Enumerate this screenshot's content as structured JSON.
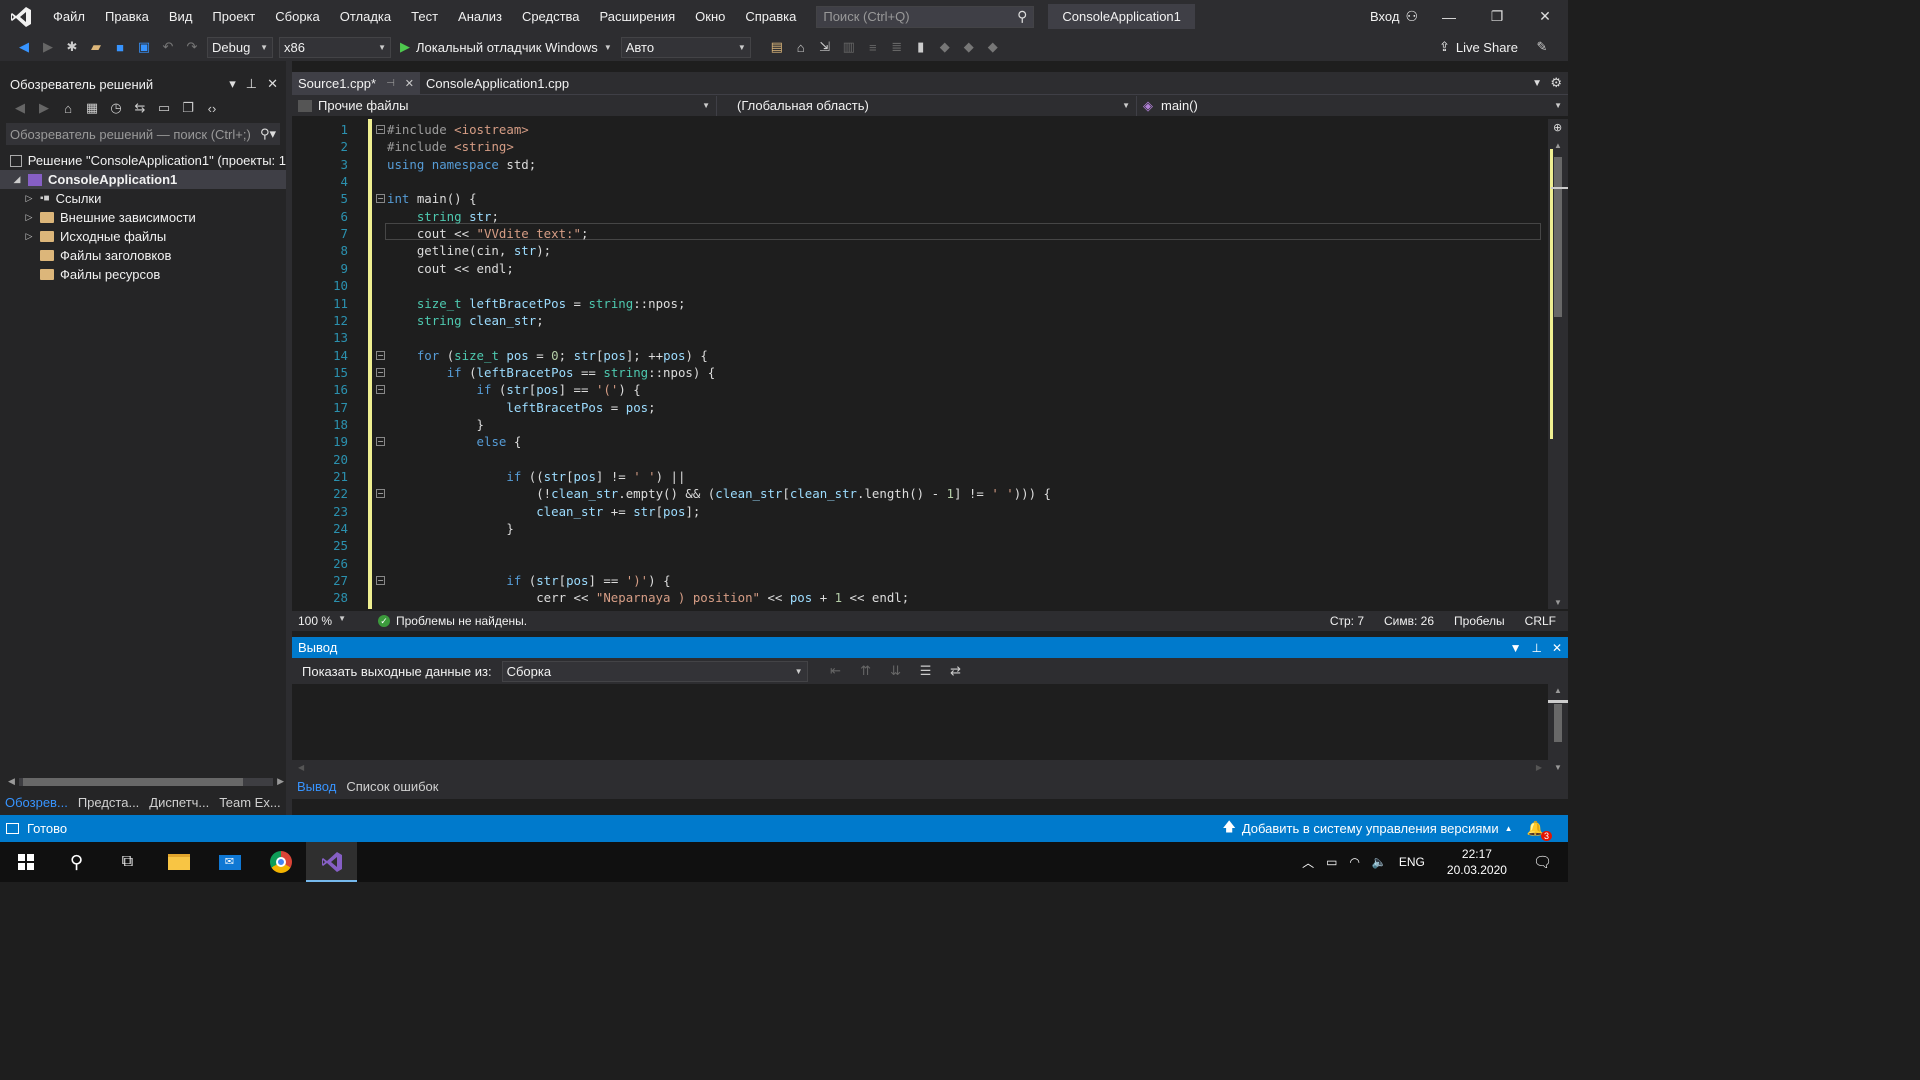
{
  "titlebar": {
    "menu": [
      "Файл",
      "Правка",
      "Вид",
      "Проект",
      "Сборка",
      "Отладка",
      "Тест",
      "Анализ",
      "Средства",
      "Расширения",
      "Окно",
      "Справка"
    ],
    "search_placeholder": "Поиск (Ctrl+Q)",
    "app_title": "ConsoleApplication1",
    "signin": "Вход"
  },
  "toolbar": {
    "config": "Debug",
    "platform": "x86",
    "run_label": "Локальный отладчик Windows",
    "run_mode": "Авто",
    "live_share": "Live Share"
  },
  "solution_explorer": {
    "title": "Обозреватель решений",
    "search_placeholder": "Обозреватель решений — поиск (Ctrl+;)",
    "solution": "Решение \"ConsoleApplication1\" (проекты: 1",
    "project": "ConsoleApplication1",
    "items": [
      "Ссылки",
      "Внешние зависимости",
      "Исходные файлы",
      "Файлы заголовков",
      "Файлы ресурсов"
    ],
    "bottom_tabs": [
      "Обозрев...",
      "Предста...",
      "Диспетч...",
      "Team Ex..."
    ]
  },
  "editor": {
    "tabs": [
      "Source1.cpp*",
      "ConsoleApplication1.cpp"
    ],
    "nav_files": "Прочие файлы",
    "nav_scope": "(Глобальная область)",
    "nav_member": "main()",
    "zoom": "100 %",
    "issues": "Проблемы не найдены.",
    "line": "Стр: 7",
    "col": "Симв: 26",
    "spaces": "Пробелы",
    "eol": "CRLF"
  },
  "code_lines": [
    {
      "n": "1",
      "html": "<span class='pp'>#include</span> <span class='st'>&lt;iostream&gt;</span>"
    },
    {
      "n": "2",
      "html": "<span class='pp'>#include</span> <span class='st'>&lt;string&gt;</span>"
    },
    {
      "n": "3",
      "html": "<span class='kw'>using namespace</span> std;"
    },
    {
      "n": "4",
      "html": ""
    },
    {
      "n": "5",
      "html": "<span class='kw'>int</span> main() {"
    },
    {
      "n": "6",
      "html": "    <span class='ty'>string</span> <span class='vr'>str</span>;"
    },
    {
      "n": "7",
      "html": "    cout &lt;&lt; <span class='st'>\"VVdite text:\"</span>;"
    },
    {
      "n": "8",
      "html": "    getline(cin, <span class='vr'>str</span>);"
    },
    {
      "n": "9",
      "html": "    cout &lt;&lt; endl;"
    },
    {
      "n": "10",
      "html": ""
    },
    {
      "n": "11",
      "html": "    <span class='ty'>size_t</span> <span class='vr'>leftBracetPos</span> = <span class='ty'>string</span>::npos;"
    },
    {
      "n": "12",
      "html": "    <span class='ty'>string</span> <span class='vr'>clean_str</span>;"
    },
    {
      "n": "13",
      "html": ""
    },
    {
      "n": "14",
      "html": "    <span class='kw'>for</span> (<span class='ty'>size_t</span> <span class='vr'>pos</span> = <span class='nm'>0</span>; <span class='vr'>str</span>[<span class='vr'>pos</span>]; ++<span class='vr'>pos</span>) {"
    },
    {
      "n": "15",
      "html": "        <span class='kw'>if</span> (<span class='vr'>leftBracetPos</span> == <span class='ty'>string</span>::npos) {"
    },
    {
      "n": "16",
      "html": "            <span class='kw'>if</span> (<span class='vr'>str</span>[<span class='vr'>pos</span>] == <span class='st'>'('</span>) {"
    },
    {
      "n": "17",
      "html": "                <span class='vr'>leftBracetPos</span> = <span class='vr'>pos</span>;"
    },
    {
      "n": "18",
      "html": "            }"
    },
    {
      "n": "19",
      "html": "            <span class='kw'>else</span> {"
    },
    {
      "n": "20",
      "html": ""
    },
    {
      "n": "21",
      "html": "                <span class='kw'>if</span> ((<span class='vr'>str</span>[<span class='vr'>pos</span>] != <span class='st'>' '</span>) ||"
    },
    {
      "n": "22",
      "html": "                    (!<span class='vr'>clean_str</span>.empty() &amp;&amp; (<span class='vr'>clean_str</span>[<span class='vr'>clean_str</span>.length() - <span class='nm'>1</span>] != <span class='st'>' '</span>))) {"
    },
    {
      "n": "23",
      "html": "                    <span class='vr'>clean_str</span> += <span class='vr'>str</span>[<span class='vr'>pos</span>];"
    },
    {
      "n": "24",
      "html": "                }"
    },
    {
      "n": "25",
      "html": ""
    },
    {
      "n": "26",
      "html": ""
    },
    {
      "n": "27",
      "html": "                <span class='kw'>if</span> (<span class='vr'>str</span>[<span class='vr'>pos</span>] == <span class='st'>')'</span>) {"
    },
    {
      "n": "28",
      "html": "                    cerr &lt;&lt; <span class='st'>\"Neparnaya ) position\"</span> &lt;&lt; <span class='vr'>pos</span> + <span class='nm'>1</span> &lt;&lt; endl;"
    }
  ],
  "output": {
    "title": "Вывод",
    "show_from": "Показать выходные данные из:",
    "source": "Сборка",
    "tabs": [
      "Вывод",
      "Список ошибок"
    ]
  },
  "statusbar": {
    "ready": "Готово",
    "vcs": "Добавить в систему управления версиями",
    "notif_count": "3"
  },
  "taskbar": {
    "lang": "ENG",
    "time": "22:17",
    "date": "20.03.2020"
  },
  "colors": {
    "accent": "#007acc",
    "vs_purple": "#865fc5"
  }
}
